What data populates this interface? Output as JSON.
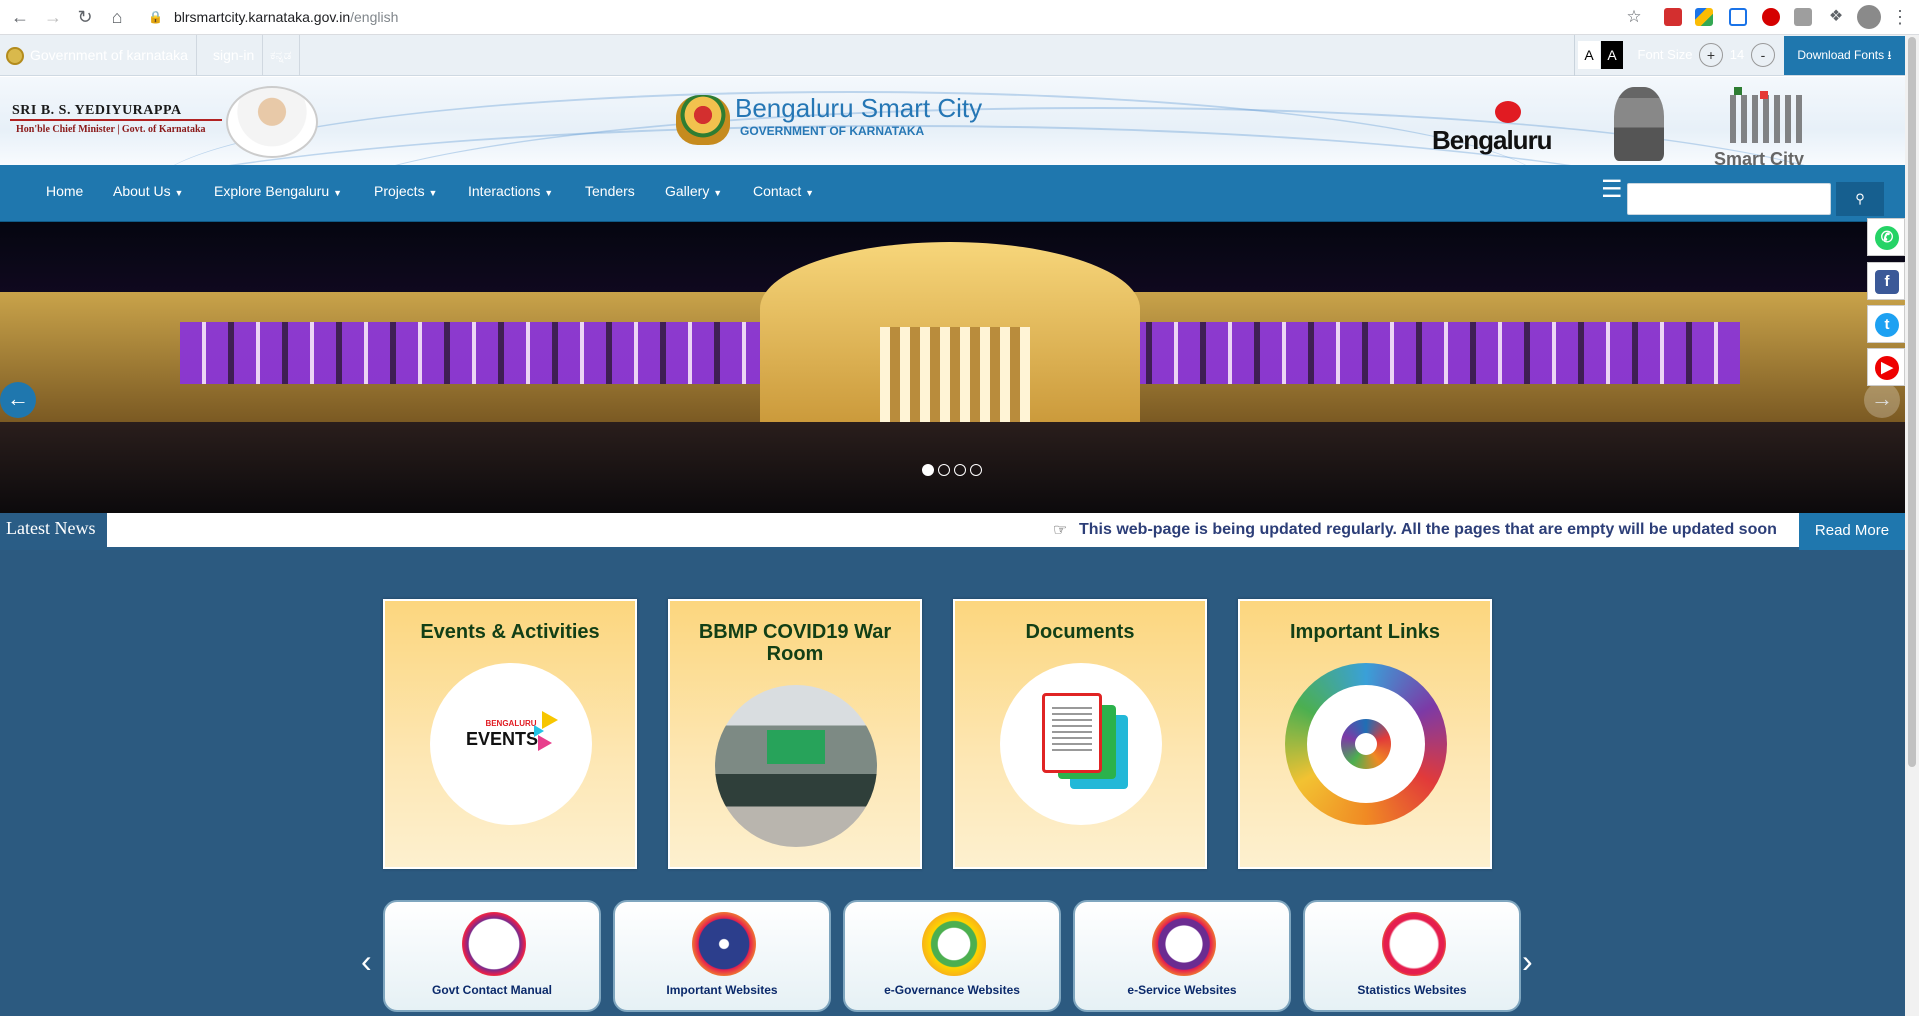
{
  "browser": {
    "url_host": "blrsmartcity.karnataka.gov.in",
    "url_path": "/english"
  },
  "govbar": {
    "gov_link": "Government of karnataka",
    "signin": "sign-in",
    "kannada": "ಕನ್ನಡ",
    "font_a_normal": "A",
    "font_a_contrast": "A",
    "font_size_label": "Font Size",
    "font_plus": "+",
    "font_size_value": "14",
    "font_minus": "-",
    "download_fonts": "Download Fonts"
  },
  "header": {
    "cm_name": "SRI B. S. YEDIYURAPPA",
    "cm_title": "Hon'ble Chief Minister | Govt. of Karnataka",
    "site_title": "Bengaluru Smart City",
    "site_subtitle": "GOVERNMENT OF KARNATAKA",
    "bengaluru_logo": "Bengaluru",
    "smart_city_logo": "Smart City"
  },
  "nav": {
    "items": [
      "Home",
      "About Us",
      "Explore Bengaluru",
      "Projects",
      "Interactions",
      "Tenders",
      "Gallery",
      "Contact"
    ],
    "dropdown": [
      false,
      true,
      true,
      true,
      true,
      false,
      true,
      true
    ],
    "search_placeholder": ""
  },
  "hero": {
    "slides": 4,
    "active_slide": 1
  },
  "ticker": {
    "label": "Latest News",
    "message": "This web-page is being updated regularly. All the pages that are empty will be updated soon",
    "read_more": "Read More"
  },
  "cards": [
    {
      "title": "Events & Activities",
      "image_text": "EVENTS",
      "image_sub": "BENGALURU"
    },
    {
      "title": "BBMP COVID19 War Room"
    },
    {
      "title": "Documents"
    },
    {
      "title": "Important Links"
    }
  ],
  "tiles": [
    {
      "label": "Govt Contact Manual",
      "icon": "phone-book-icon"
    },
    {
      "label": "Important Websites",
      "icon": "globe-icon"
    },
    {
      "label": "e-Governance Websites",
      "icon": "ceg-icon"
    },
    {
      "label": "e-Service Websites",
      "icon": "at-sign-icon"
    },
    {
      "label": "Statistics Websites",
      "icon": "newspaper-icon"
    }
  ],
  "social": [
    "whatsapp",
    "facebook",
    "twitter",
    "youtube"
  ],
  "colors": {
    "nav_blue": "#1f77ae",
    "content_bg": "#2c5a80",
    "card_gold": "#fcd67e",
    "title_green": "#123f16",
    "tile_label": "#0b2a6b"
  }
}
